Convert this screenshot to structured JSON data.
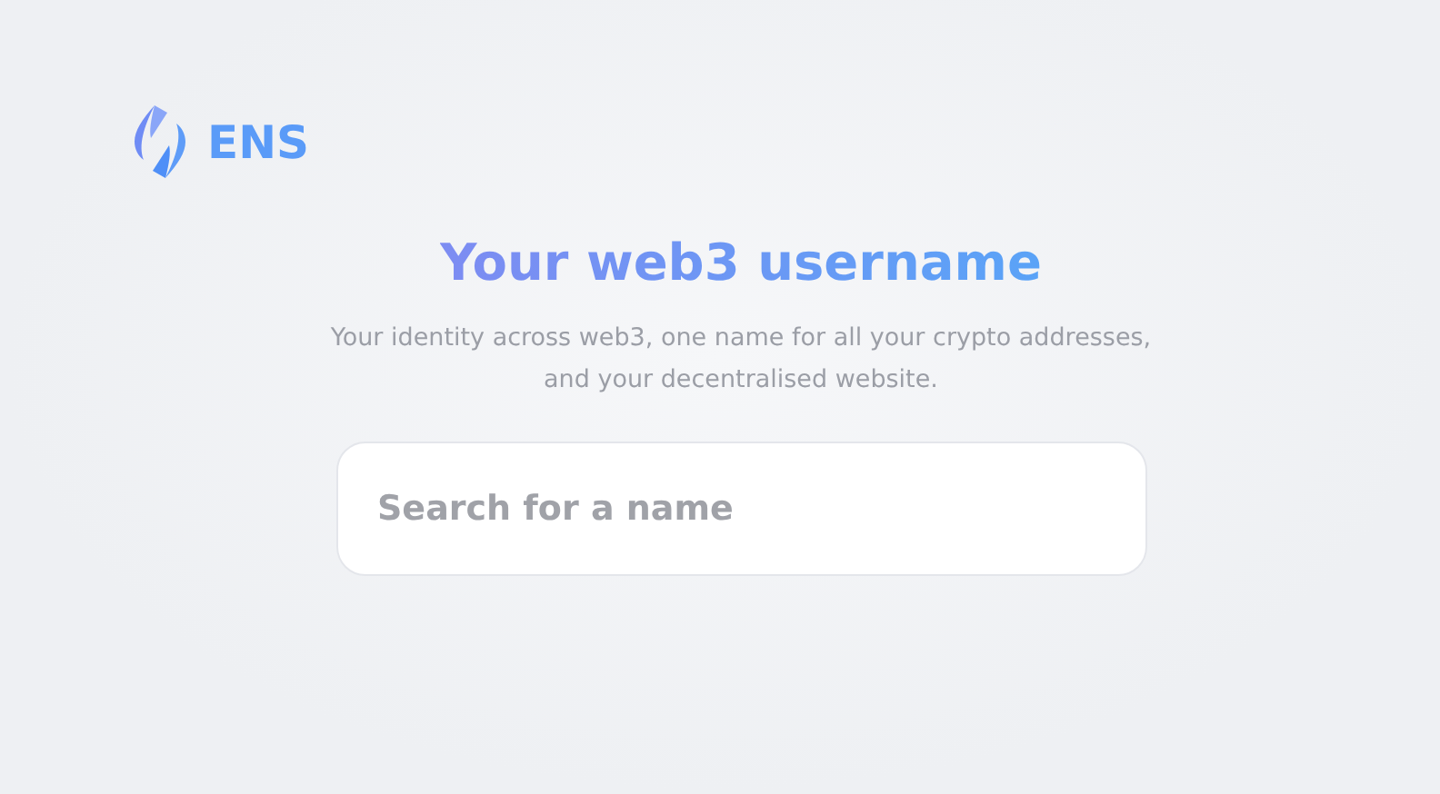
{
  "logo": {
    "text": "ENS"
  },
  "hero": {
    "title": "Your web3 username",
    "subtitle_lines": [
      "Your identity across web3, one name for all your crypto addresses,",
      "and your decentralised website."
    ]
  },
  "search": {
    "placeholder": "Search for a name"
  }
}
